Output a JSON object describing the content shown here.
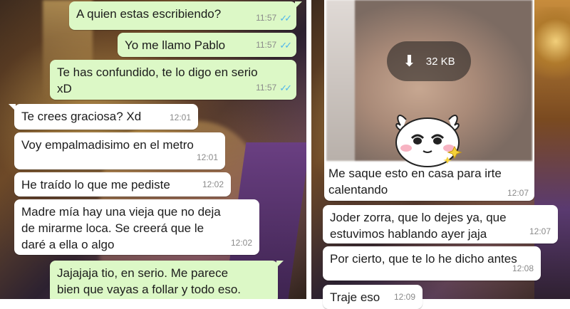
{
  "left_chat": {
    "messages": [
      {
        "dir": "out",
        "text": "A quien estas escribiendo?",
        "time": "11:57"
      },
      {
        "dir": "out",
        "text": "Yo me llamo Pablo",
        "time": "11:57"
      },
      {
        "dir": "out",
        "text": "Te has confundido, te lo digo en serio\nxD",
        "time": "11:57"
      },
      {
        "dir": "in",
        "text": "Te crees graciosa? Xd",
        "time": "12:01"
      },
      {
        "dir": "in",
        "text": "Voy empalmadisimo en el metro",
        "time": "12:01"
      },
      {
        "dir": "in",
        "text": "He traído lo que me pediste",
        "time": "12:02"
      },
      {
        "dir": "in",
        "text": "Madre mía hay una vieja que no deja\nde mirarme loca. Se creerá que le\ndaré a ella o algo",
        "time": "12:02"
      },
      {
        "dir": "out",
        "text": "Jajajaja tio, en serio. Me parece\nbien que vayas a follar y todo eso.",
        "time": ""
      }
    ]
  },
  "right_chat": {
    "image_message": {
      "download_size": "32 KB",
      "caption": "Me saque esto en casa para irte\ncalentando",
      "time": "12:07"
    },
    "messages": [
      {
        "dir": "in",
        "text": "Joder zorra, que lo dejes ya, que\nestuvimos hablando ayer jaja",
        "time": "12:07"
      },
      {
        "dir": "in",
        "text": "Por cierto, que te lo he dicho antes",
        "time": "12:08"
      },
      {
        "dir": "in",
        "text": "Traje eso",
        "time": "12:09"
      }
    ]
  },
  "icons": {
    "read_receipt": "double-check-icon",
    "download": "download-arrow-icon",
    "sticker": "cartoon-face-sticker"
  },
  "colors": {
    "outgoing_bubble": "#dcf8c6",
    "incoming_bubble": "#ffffff",
    "read_ticks": "#4fb6ec"
  }
}
